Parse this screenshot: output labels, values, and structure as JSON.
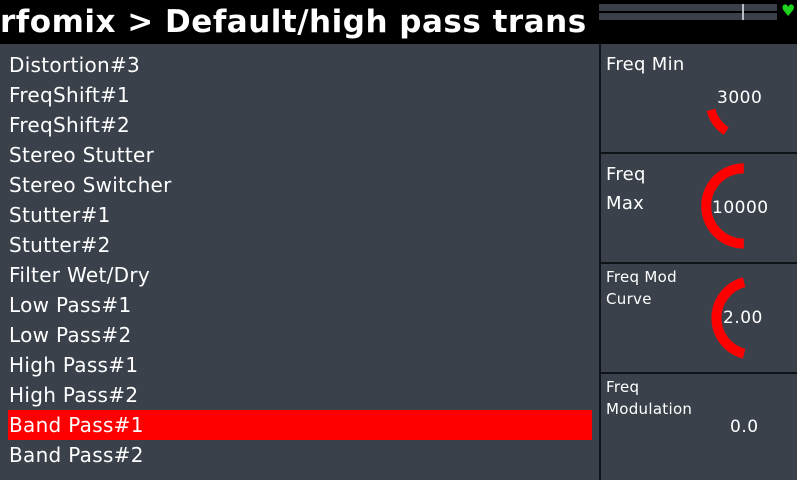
{
  "header": {
    "title": "rfomix > Default/high pass trans",
    "status_icon": "heart-icon",
    "status_color": "#1fd11f"
  },
  "modules": {
    "items": [
      {
        "label": "Distortion#3",
        "selected": false
      },
      {
        "label": "FreqShift#1",
        "selected": false
      },
      {
        "label": "FreqShift#2",
        "selected": false
      },
      {
        "label": "Stereo Stutter",
        "selected": false
      },
      {
        "label": "Stereo Switcher",
        "selected": false
      },
      {
        "label": "Stutter#1",
        "selected": false
      },
      {
        "label": "Stutter#2",
        "selected": false
      },
      {
        "label": "Filter Wet/Dry",
        "selected": false
      },
      {
        "label": "Low Pass#1",
        "selected": false
      },
      {
        "label": "Low Pass#2",
        "selected": false
      },
      {
        "label": "High Pass#1",
        "selected": false
      },
      {
        "label": "High Pass#2",
        "selected": false
      },
      {
        "label": "Band Pass#1",
        "selected": true
      },
      {
        "label": "Band Pass#2",
        "selected": false
      }
    ],
    "selected_color": "#ff0000"
  },
  "params": [
    {
      "label_line1": "Freq Min",
      "label_line2": "",
      "value": "3000",
      "level": 0.15
    },
    {
      "label_line1": "Freq",
      "label_line2": "Max",
      "value": "10000",
      "level": 0.5
    },
    {
      "label_line1": "Freq Mod",
      "label_line2": "Curve",
      "value": "2.00",
      "level": 0.5
    },
    {
      "label_line1": "Freq",
      "label_line2": "Modulation",
      "value": "0.0",
      "level": 0.0
    }
  ],
  "colors": {
    "panel_bg": "#3a414b",
    "knob_arc": "#ff0000",
    "header_bg": "#000000"
  }
}
